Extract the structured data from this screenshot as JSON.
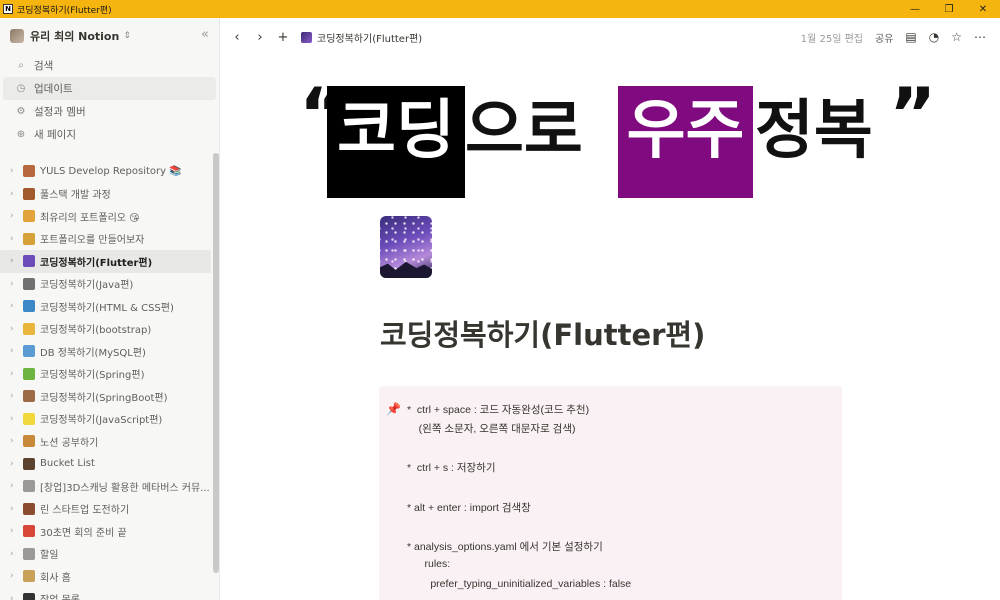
{
  "window": {
    "title": "코딩정복하기(Flutter편)",
    "controls": [
      "—",
      "❐",
      "✕"
    ]
  },
  "sidebar": {
    "workspace": "유리 최의 Notion",
    "menu": [
      {
        "label": "검색",
        "icon": "search-icon"
      },
      {
        "label": "업데이트",
        "icon": "clock-icon"
      },
      {
        "label": "설정과 멤버",
        "icon": "gear-icon"
      },
      {
        "label": "새 페이지",
        "icon": "plus-circle-icon"
      }
    ],
    "pages": [
      {
        "label": "YULS Develop Repository 📚",
        "icon": "book-icon",
        "color": "#b7693e"
      },
      {
        "label": "풀스택 개발 과정",
        "icon": "ant-icon",
        "color": "#a05a2c"
      },
      {
        "label": "최유리의 포트폴리오 😘",
        "icon": "planet-icon",
        "color": "#e3a33b"
      },
      {
        "label": "포트폴리오를 만들어보자",
        "icon": "trophy-icon",
        "color": "#d6a136"
      },
      {
        "label": "코딩정복하기(Flutter편)",
        "icon": "galaxy-icon",
        "color": "#6b4cba"
      },
      {
        "label": "코딩정복하기(Java편)",
        "icon": "laptop-icon",
        "color": "#707070"
      },
      {
        "label": "코딩정복하기(HTML & CSS편)",
        "icon": "globe-icon",
        "color": "#3c87c6"
      },
      {
        "label": "코딩정복하기(bootstrap)",
        "icon": "smile-icon",
        "color": "#e9b53c"
      },
      {
        "label": "DB 정복하기(MySQL편)",
        "icon": "database-icon",
        "color": "#5a9bd4"
      },
      {
        "label": "코딩정복하기(Spring편)",
        "icon": "spring-leaf-icon",
        "color": "#6db33f"
      },
      {
        "label": "코딩정복하기(SpringBoot편)",
        "icon": "robot-icon",
        "color": "#9c6b45"
      },
      {
        "label": "코딩정복하기(JavaScript편)",
        "icon": "js-icon",
        "color": "#f0d83a"
      },
      {
        "label": "노션 공부하기",
        "icon": "hourglass-icon",
        "color": "#c88a3a"
      },
      {
        "label": "Bucket List",
        "icon": "bucket-icon",
        "color": "#5b4330"
      },
      {
        "label": "[창업]3D스캐닝 활용한 메타버스 커뮤...",
        "icon": "page-icon",
        "color": "#9b9a97"
      },
      {
        "label": "린 스타트업 도전하기",
        "icon": "rocket-icon",
        "color": "#8a4b2e"
      },
      {
        "label": "30초면 회의 준비 끝",
        "icon": "pin-icon",
        "color": "#d9473b"
      },
      {
        "label": "할일",
        "icon": "page-icon",
        "color": "#9b9a97"
      },
      {
        "label": "회사 홈",
        "icon": "house-icon",
        "color": "#c9a25a"
      },
      {
        "label": "작업 목록",
        "icon": "check-icon",
        "color": "#333333"
      }
    ],
    "selected_index": 4
  },
  "topbar": {
    "breadcrumb": "코딩정복하기(Flutter편)",
    "edited": "1월 25일 편집",
    "share": "공유"
  },
  "banner": {
    "quote_open": "“",
    "word1": "코딩",
    "word2": "으로",
    "word3": "우주",
    "word4": "정복",
    "quote_close": "”",
    "accent_black": "#000000",
    "accent_purple": "#800a80"
  },
  "page": {
    "title": "코딩정복하기(Flutter편)",
    "callout_icon": "pushpin-icon",
    "callout_bg": "#f9f1f3",
    "lines": [
      "*  ctrl + space : 코드 자동완성(코드 추천)",
      "    (왼쪽 소문자, 오른쪽 대문자로 검색)",
      "*  ctrl + s : 저장하기",
      "* alt + enter : import 검색창",
      "* analysis_options.yaml 에서 기본 설정하기",
      "      rules:",
      "        prefer_typing_uninitialized_variables : false"
    ]
  }
}
